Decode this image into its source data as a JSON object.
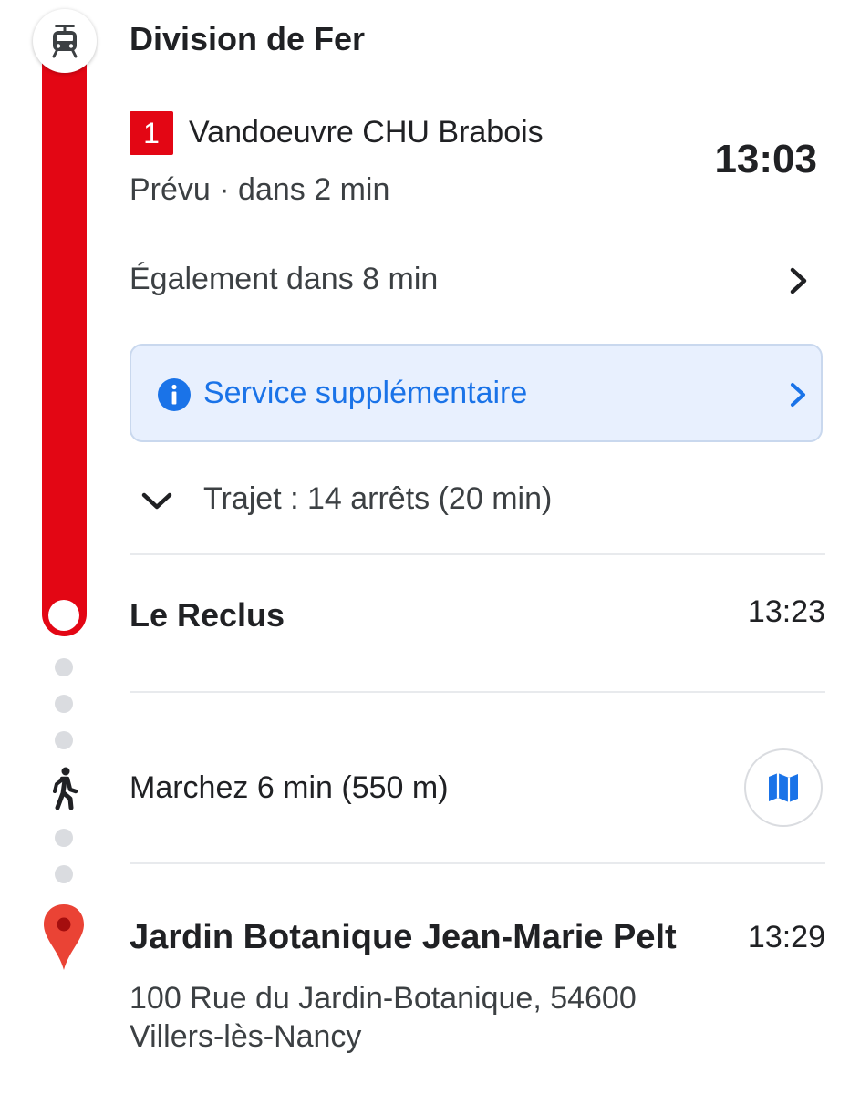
{
  "colors": {
    "line": "#e30614",
    "accent_blue": "#1a73e8",
    "alert_bg": "#e8f0fe",
    "dot_grey": "#dadce0"
  },
  "icons": {
    "transit": "tram-icon",
    "walk": "walk-icon",
    "destination": "location-pin-icon",
    "alert": "info-icon",
    "map": "map-icon"
  },
  "departure": {
    "stop_name": "Division de Fer",
    "line_number": "1",
    "direction": "Vandoeuvre CHU Brabois",
    "time": "13:03",
    "status": "Prévu · dans 2 min",
    "also": "Également dans 8 min"
  },
  "alert": {
    "label": "Service supplémentaire"
  },
  "trip": {
    "label": "Trajet : 14 arrêts (20 min)"
  },
  "arrival_stop": {
    "name": "Le Reclus",
    "time": "13:23"
  },
  "walk": {
    "label": "Marchez 6 min (550 m)"
  },
  "destination": {
    "name": "Jardin Botanique Jean-Marie Pelt",
    "time": "13:29",
    "address_line1": "100 Rue du Jardin-Botanique, 54600",
    "address_line2": "Villers-lès-Nancy"
  }
}
